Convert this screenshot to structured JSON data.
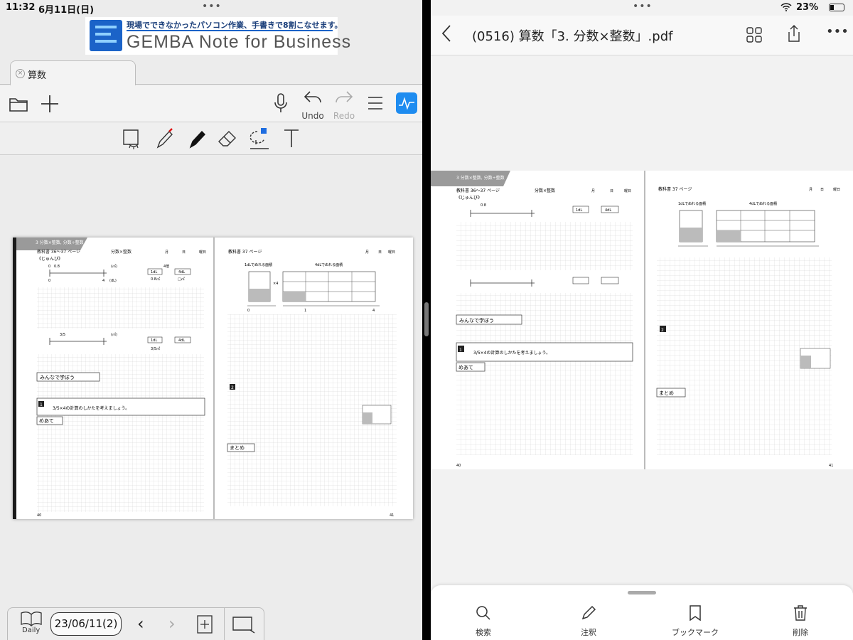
{
  "left": {
    "status": {
      "time": "11:32",
      "date": "6月11日(日)"
    },
    "banner": {
      "tagline": "現場でできなかったパソコン作業、手書きで8割こなせます。",
      "name": "GEMBA Note for Business"
    },
    "tab": {
      "name": "算数"
    },
    "toolbar": {
      "undo_label": "Undo",
      "redo_label": "Redo"
    },
    "bottom": {
      "daily_label": "Daily",
      "date_value": "23/06/11(2)"
    }
  },
  "worksheet": {
    "unit_title": "3 分数×整数, 分数÷整数",
    "textbook_left": "教科書 36〜37 ページ",
    "topic": "分数×整数",
    "date_fields": [
      "月",
      "日",
      "曜日"
    ],
    "textbook_right": "教科書 37 ページ",
    "junbi": "《じゅんび》",
    "num_08": "0.8",
    "unit_m2": "(㎡)",
    "unit_dl": "(dL)",
    "axis_0": "0",
    "axis_1": "1",
    "axis_4": "4",
    "times4": "4倍",
    "box_1dl": "1dL",
    "box_4dl": "4dL",
    "m08": "0.8㎡",
    "m_blank": "□㎡",
    "frac_35": "3/5",
    "frac_35m": "3/5㎡",
    "area_1dl": "1dLでぬれる面積",
    "area_4dl": "4dLでぬれる面積",
    "one_m2": "1㎡",
    "x4": "×4",
    "minna": "みんなで学ぼう",
    "problem_no": "1",
    "problem_text": "3/5×4の計算のしかたを考えましょう。",
    "meate": "めあて",
    "section2": "2",
    "matome": "まとめ",
    "page_left": "40",
    "page_right": "41"
  },
  "right": {
    "status": {
      "battery": "23%"
    },
    "nav": {
      "title": "(0516) 算数「3. 分数×整数」.pdf"
    },
    "bottom": {
      "search": "検索",
      "annotate": "注釈",
      "bookmark": "ブックマーク",
      "delete": "削除"
    }
  }
}
